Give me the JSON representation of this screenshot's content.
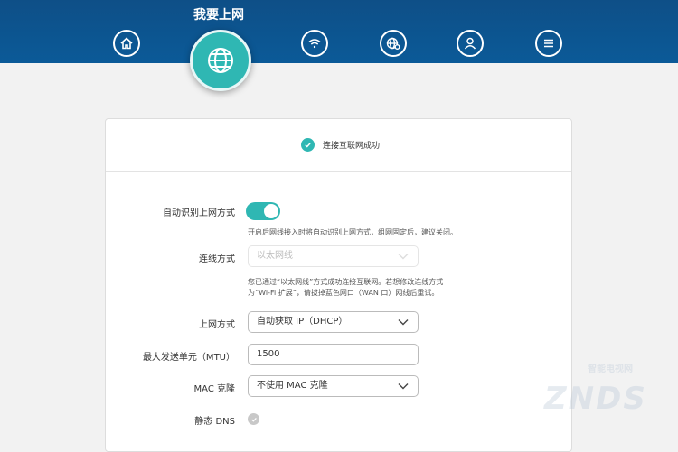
{
  "header": {
    "title": "我要上网",
    "nav": [
      {
        "icon": "home-icon"
      },
      {
        "icon": "globe-icon",
        "active": true
      },
      {
        "icon": "wifi-icon"
      },
      {
        "icon": "globe-settings-icon"
      },
      {
        "icon": "user-icon"
      },
      {
        "icon": "menu-icon"
      }
    ],
    "bg_color": "#0b5a98",
    "accent": "#2fb7b3"
  },
  "status": {
    "text": "连接互联网成功"
  },
  "form": {
    "auto_detect_label": "自动识别上网方式",
    "auto_detect_on": true,
    "auto_detect_hint": "开启后网线接入时将自动识别上网方式，组网固定后，建议关闭。",
    "conn_mode_label": "连线方式",
    "conn_mode_value": "以太网线",
    "conn_hint_line1": "您已通过“以太网线”方式成功连接互联网。若想修改连线方式",
    "conn_hint_line2": "为“Wi-Fi 扩展”，请拔掉蓝色网口（WAN 口）网线后重试。",
    "wan_type_label": "上网方式",
    "wan_type_value": "自动获取 IP（DHCP）",
    "mtu_label": "最大发送单元（MTU）",
    "mtu_value": "1500",
    "mac_label": "MAC 克隆",
    "mac_value": "不使用 MAC 克隆",
    "dns_label": "静态 DNS"
  },
  "watermark": {
    "text": "ZNDS",
    "sub": "智能电视网"
  }
}
